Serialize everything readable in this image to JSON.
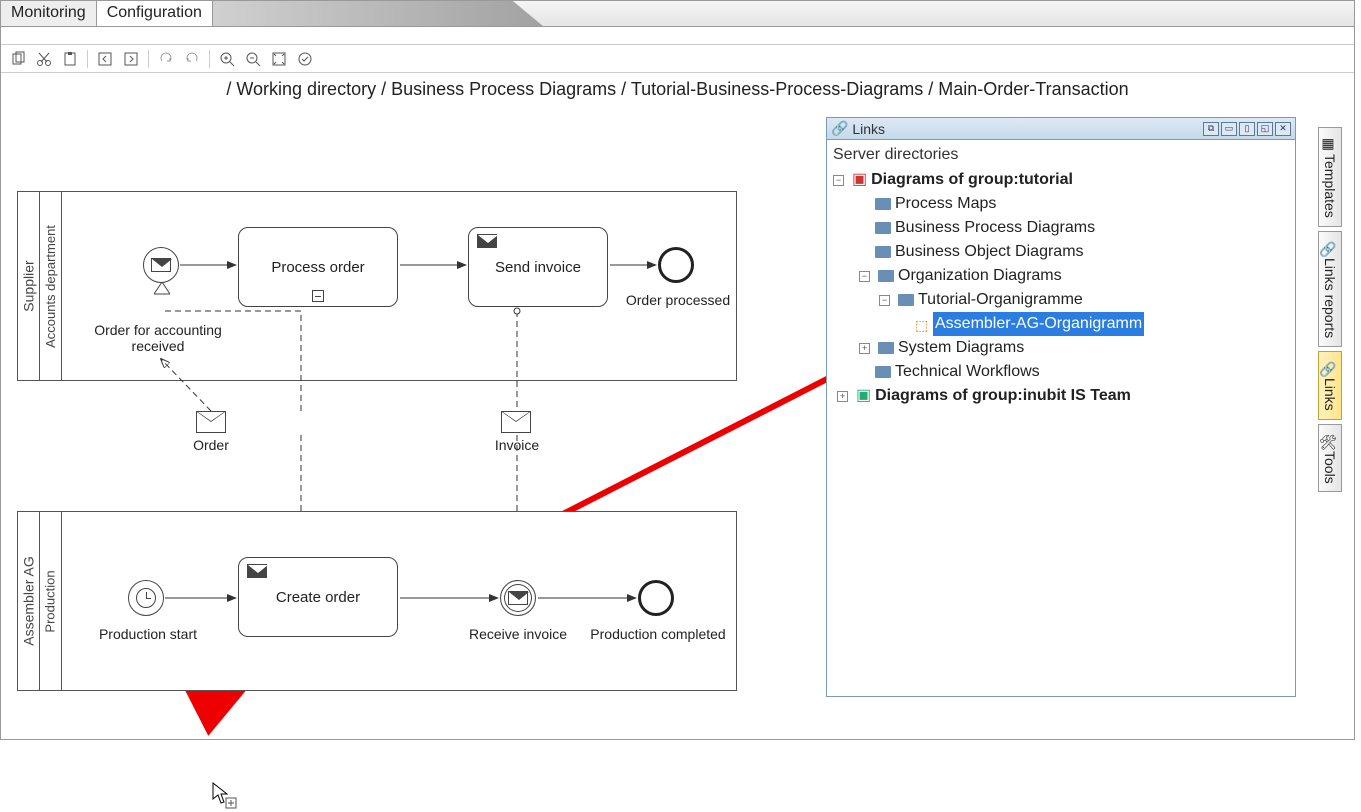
{
  "tabs": {
    "monitoring": "Monitoring",
    "configuration": "Configuration"
  },
  "breadcrumb": "/ Working directory / Business Process Diagrams / Tutorial-Business-Process-Diagrams / Main-Order-Transaction",
  "pool1": {
    "name": "Supplier",
    "lane": "Accounts department",
    "startLabel": "Order for accounting received",
    "task1": "Process order",
    "task2": "Send invoice",
    "endLabel": "Order processed"
  },
  "pool2": {
    "name": "Assembler AG",
    "lane": "Production",
    "startLabel": "Production start",
    "task1": "Create order",
    "evtLabel": "Receive invoice",
    "endLabel": "Production completed"
  },
  "msg1": "Order",
  "msg2": "Invoice",
  "panel": {
    "title": "Links",
    "subtitle": "Server directories",
    "tree": {
      "root1": "Diagrams of group:tutorial",
      "n1": "Process Maps",
      "n2": "Business Process Diagrams",
      "n3": "Business Object Diagrams",
      "n4": "Organization Diagrams",
      "n4a": "Tutorial-Organigramme",
      "n4a1": "Assembler-AG-Organigramm",
      "n5": "System Diagrams",
      "n6": "Technical Workflows",
      "root2": "Diagrams of group:inubit IS Team"
    }
  },
  "sidetabs": {
    "templates": "Templates",
    "linksreports": "Links reports",
    "links": "Links",
    "tools": "Tools"
  }
}
